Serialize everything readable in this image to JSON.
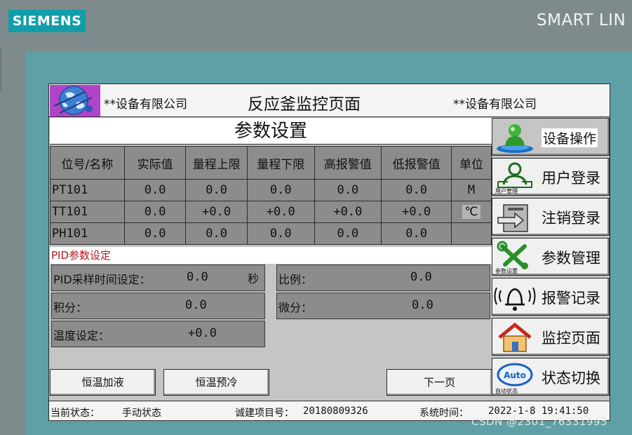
{
  "brand": {
    "logo": "SIEMENS",
    "series": "SMART LIN"
  },
  "header": {
    "company_left": "**设备有限公司",
    "title": "反应釜监控页面",
    "company_right": "**设备有限公司"
  },
  "section_title": "参数设置",
  "table": {
    "headers": [
      "位号/名称",
      "实际值",
      "量程上限",
      "量程下限",
      "高报警值",
      "低报警值",
      "单位"
    ],
    "rows": [
      [
        "PT101",
        "0.0",
        "0.0",
        "0.0",
        "0.0",
        "0.0",
        "M"
      ],
      [
        "TT101",
        "0.0",
        "+0.0",
        "+0.0",
        "+0.0",
        "+0.0",
        "℃"
      ],
      [
        "PH101",
        "0.0",
        "0.0",
        "0.0",
        "0.0",
        "0.0",
        ""
      ]
    ]
  },
  "pid": {
    "section_label": "PID参数设定",
    "sample_time": {
      "label": "PID采样时间设定：",
      "value": "0.0",
      "unit": "秒"
    },
    "proportional": {
      "label": "比例：",
      "value": "0.0"
    },
    "integral": {
      "label": "积分：",
      "value": "0.0"
    },
    "derivative": {
      "label": "微分：",
      "value": "0.0"
    },
    "temperature": {
      "label": "温度设定：",
      "value": "+0.0"
    }
  },
  "buttons": {
    "heat_fill": "恒温加液",
    "precool": "恒温预冷",
    "next_page": "下一页"
  },
  "nav": [
    {
      "label": "设备操作",
      "icon": "device-operation-icon",
      "caption": ""
    },
    {
      "label": "用户登录",
      "icon": "user-management-icon",
      "caption": "用户管理"
    },
    {
      "label": "注销登录",
      "icon": "logout-icon",
      "caption": ""
    },
    {
      "label": "参数管理",
      "icon": "tools-icon",
      "caption": "参数设置"
    },
    {
      "label": "报警记录",
      "icon": "alarm-bell-icon",
      "caption": ""
    },
    {
      "label": "监控页面",
      "icon": "home-icon",
      "caption": ""
    },
    {
      "label": "状态切换",
      "icon": "auto-mode-icon",
      "caption": "自动状态"
    }
  ],
  "status": {
    "state_label": "当前状态：",
    "state_value": "手动状态",
    "project_label": "诚建项目号：",
    "project_value": "20180809326",
    "time_label": "系统时间：",
    "time_value": "2022-1-8  19:41:50"
  },
  "watermark": "CSDN @2301_76331995",
  "colors": {
    "bezel": "#5fa0a6",
    "siemens_teal": "#109eaa",
    "cell_gray": "#8c8c8c",
    "panel_gray": "#c5c5c5",
    "pid_label_red": "#b8141e"
  }
}
